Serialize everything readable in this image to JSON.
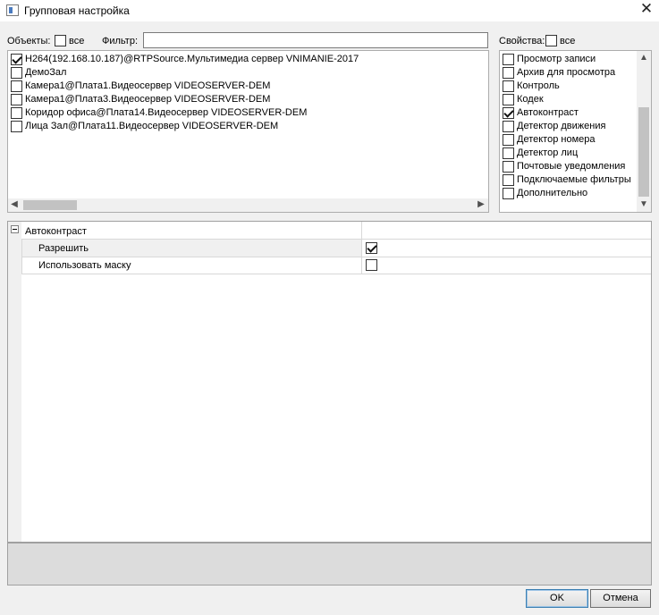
{
  "window": {
    "title": "Групповая настройка",
    "close_glyph": "✕"
  },
  "objects": {
    "label": "Объекты:",
    "all_label": "все",
    "all_checked": false,
    "filter_label": "Фильтр:",
    "filter_value": "",
    "items": [
      {
        "label": "H264(192.168.10.187)@RTPSource.Мультимедиа сервер VNIMANIE-2017",
        "checked": true
      },
      {
        "label": "ДемоЗал",
        "checked": false
      },
      {
        "label": "Камера1@Плата1.Видеосервер VIDEOSERVER-DEM",
        "checked": false
      },
      {
        "label": "Камера1@Плата3.Видеосервер VIDEOSERVER-DEM",
        "checked": false
      },
      {
        "label": "Коридор офиса@Плата14.Видеосервер VIDEOSERVER-DEM",
        "checked": false
      },
      {
        "label": "Лица Зал@Плата11.Видеосервер VIDEOSERVER-DEM",
        "checked": false
      }
    ]
  },
  "properties": {
    "label": "Свойства:",
    "all_label": "все",
    "all_checked": false,
    "items": [
      {
        "label": "Просмотр записи",
        "checked": false
      },
      {
        "label": "Архив для просмотра",
        "checked": false
      },
      {
        "label": "Контроль",
        "checked": false
      },
      {
        "label": "Кодек",
        "checked": false
      },
      {
        "label": "Автоконтраст",
        "checked": true
      },
      {
        "label": "Детектор движения",
        "checked": false
      },
      {
        "label": "Детектор номера",
        "checked": false
      },
      {
        "label": "Детектор лиц",
        "checked": false
      },
      {
        "label": "Почтовые уведомления",
        "checked": false
      },
      {
        "label": "Подключаемые фильтры",
        "checked": false
      },
      {
        "label": "Дополнительно",
        "checked": false
      }
    ]
  },
  "property_grid": {
    "category": "Автоконтраст",
    "rows": [
      {
        "name": "Разрешить",
        "checked": true
      },
      {
        "name": "Использовать маску",
        "checked": false
      }
    ]
  },
  "buttons": {
    "ok": "OK",
    "cancel": "Отмена"
  }
}
